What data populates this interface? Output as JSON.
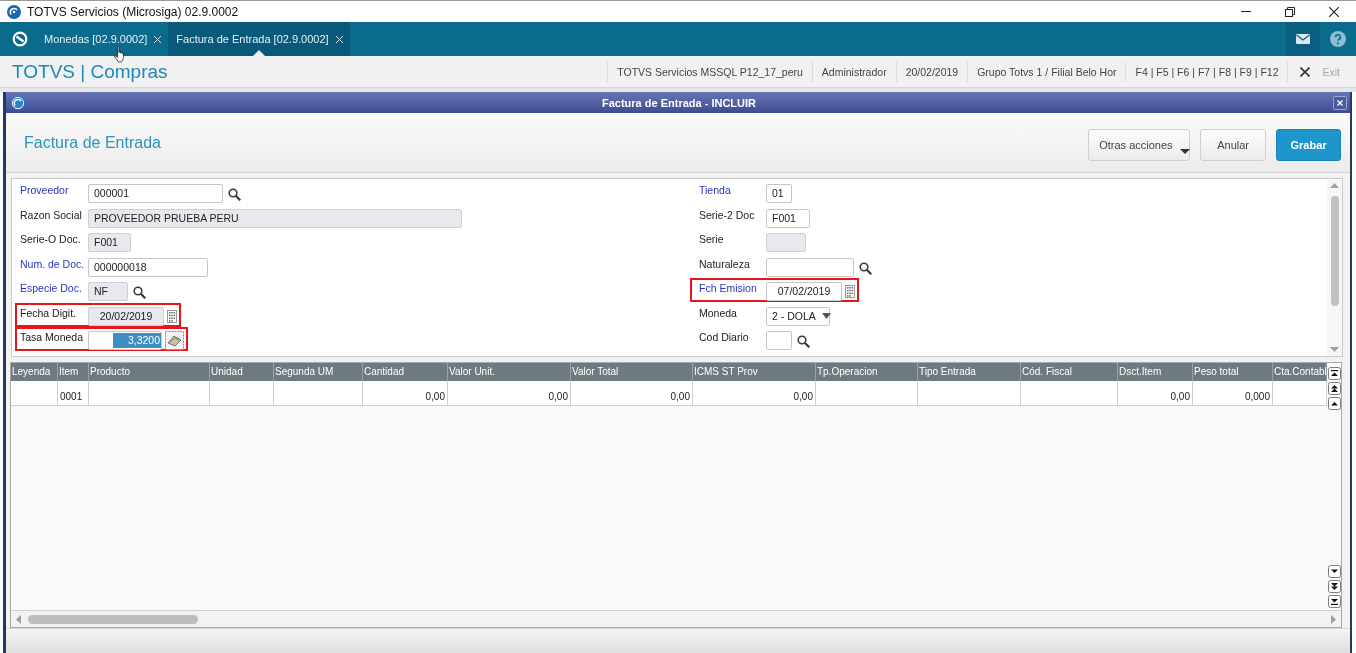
{
  "window": {
    "title": "TOTVS Servicios (Microsiga) 02.9.0002"
  },
  "tabs": [
    {
      "label": "Monedas [02.9.0002]",
      "selected": false
    },
    {
      "label": "Factura de Entrada [02.9.0002]",
      "selected": true
    }
  ],
  "app_header": {
    "title": "TOTVS | Compras",
    "info": [
      "TOTVS Servicios MSSQL P12_17_peru",
      "Administrador",
      "20/02/2019",
      "Grupo Totvs 1 / Filial Belo Hor",
      "F4 | F5 | F6 | F7 | F8 | F9 | F12"
    ],
    "exit": {
      "label": "Exit",
      "disabled": true
    }
  },
  "dialog": {
    "title": "Factura de Entrada - INCLUIR",
    "heading": "Factura de Entrada",
    "actions": [
      {
        "label": "Otras acciones",
        "kind": "menu"
      },
      {
        "label": "Anular",
        "kind": "secondary"
      },
      {
        "label": "Grabar",
        "kind": "primary"
      }
    ]
  },
  "form": {
    "left": [
      {
        "label": "Proveedor",
        "value": "000001",
        "kind": "lookup",
        "required": true,
        "disabled": false,
        "highlighted": false
      },
      {
        "label": "Razon Social",
        "value": "PROVEEDOR PRUEBA PERU",
        "kind": "text",
        "required": false,
        "disabled": true,
        "highlighted": false
      },
      {
        "label": "Serie-O Doc.",
        "value": "F001",
        "kind": "text",
        "required": false,
        "disabled": true,
        "highlighted": false
      },
      {
        "label": "Num. de Doc.",
        "value": "000000018",
        "kind": "text",
        "required": true,
        "disabled": false,
        "highlighted": false
      },
      {
        "label": "Especie Doc.",
        "value": "NF",
        "kind": "lookup",
        "required": true,
        "disabled": true,
        "highlighted": false
      },
      {
        "label": "Fecha Digit.",
        "value": "20/02/2019",
        "kind": "date",
        "required": false,
        "disabled": true,
        "highlighted": true
      },
      {
        "label": "Tasa Moneda",
        "value": "3,3200",
        "kind": "calc",
        "required": false,
        "disabled": false,
        "highlighted": true,
        "value_selected": true
      }
    ],
    "right": [
      {
        "label": "Tienda",
        "value": "01",
        "kind": "text",
        "required": true,
        "disabled": false,
        "highlighted": false
      },
      {
        "label": "Serie-2 Doc",
        "value": "F001",
        "kind": "text",
        "required": false,
        "disabled": false,
        "highlighted": false
      },
      {
        "label": "Serie",
        "kind": "text",
        "required": false,
        "disabled": true,
        "highlighted": false
      },
      {
        "label": "Naturaleza",
        "kind": "lookup",
        "required": false,
        "disabled": false,
        "highlighted": false
      },
      {
        "label": "Fch Emision",
        "value": "07/02/2019",
        "kind": "date",
        "required": true,
        "disabled": false,
        "highlighted": true
      },
      {
        "label": "Moneda",
        "value": "2 - DOLA",
        "kind": "select",
        "required": false,
        "disabled": false,
        "highlighted": false
      },
      {
        "label": "Cod Diario",
        "kind": "lookup",
        "required": false,
        "disabled": false,
        "highlighted": false
      }
    ]
  },
  "grid": {
    "columns": [
      {
        "label": "Leyenda",
        "kind": "text"
      },
      {
        "label": "Item",
        "kind": "text"
      },
      {
        "label": "Producto",
        "kind": "text"
      },
      {
        "label": "Unidad",
        "kind": "text"
      },
      {
        "label": "Segunda UM",
        "kind": "text"
      },
      {
        "label": "Cantidad",
        "kind": "number"
      },
      {
        "label": "Valor Unit.",
        "kind": "number"
      },
      {
        "label": "Valor Total",
        "kind": "number"
      },
      {
        "label": "ICMS ST Prov",
        "kind": "number"
      },
      {
        "label": "Tp.Operacion",
        "kind": "text"
      },
      {
        "label": "Tipo Entrada",
        "kind": "text"
      },
      {
        "label": "Cód. Fiscal",
        "kind": "text"
      },
      {
        "label": "Dsct.Item",
        "kind": "number"
      },
      {
        "label": "Peso total",
        "kind": "number"
      },
      {
        "label": "Cta.Contabl",
        "kind": "text"
      }
    ],
    "rows": [
      {
        "cells": [
          null,
          "0001",
          null,
          null,
          null,
          "0,00",
          "0,00",
          "0,00",
          "0,00",
          null,
          null,
          null,
          "0,00",
          "0,000",
          null
        ]
      }
    ]
  }
}
